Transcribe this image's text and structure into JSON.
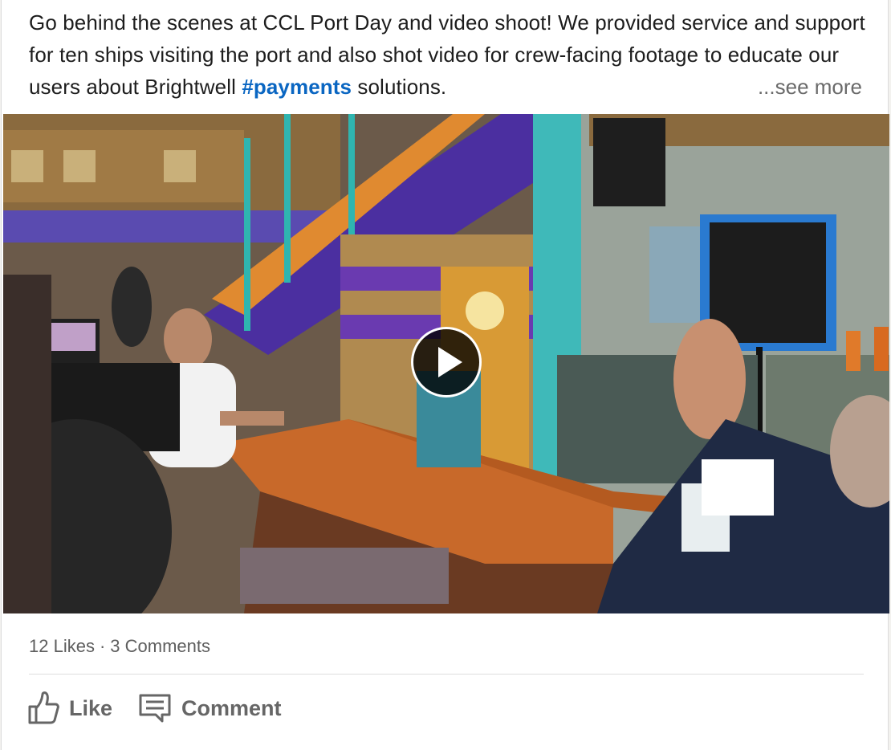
{
  "post": {
    "text_part1": "Go behind the scenes at CCL Port Day and video shoot! We provided service and support for ten ships visiting the port and also shot video for crew-facing footage to educate our users about Brightwell ",
    "hashtag": "#payments",
    "text_part2": " solutions.",
    "see_more_label": "...see more"
  },
  "media": {
    "type": "video",
    "play_icon": "play-icon"
  },
  "social": {
    "likes": "12 Likes",
    "separator": "·",
    "comments": "3 Comments"
  },
  "actions": {
    "like_label": "Like",
    "like_icon": "thumbs-up-icon",
    "comment_label": "Comment",
    "comment_icon": "speech-bubble-icon"
  },
  "colors": {
    "hashtag": "#0a66c2",
    "action_text": "#666666",
    "body_text": "#1d1d1d"
  }
}
